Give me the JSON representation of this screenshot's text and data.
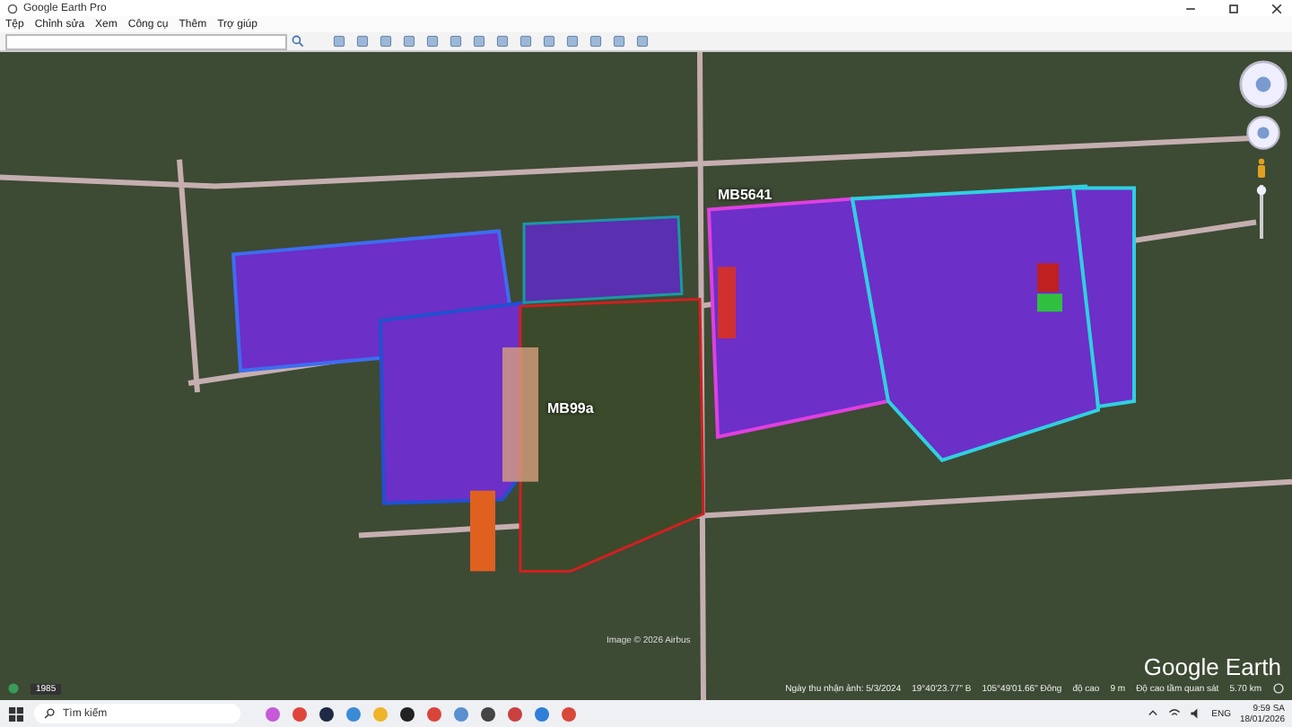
{
  "window": {
    "title": "Google Earth Pro"
  },
  "menu": [
    "Tệp",
    "Chỉnh sửa",
    "Xem",
    "Công cụ",
    "Thêm",
    "Trợ giúp"
  ],
  "map": {
    "labels": [
      {
        "text": "MB5641",
        "kind": "top"
      },
      {
        "text": "MB99a",
        "kind": "left"
      }
    ],
    "attribution": "Image © 2026 Airbus",
    "logo": "Google Earth",
    "history_badge": "1985",
    "status": [
      "Ngày thu nhận ảnh: 5/3/2024",
      "19°40'23.77\" B",
      "105°49'01.66\" Đông",
      "độ cao",
      "9 m",
      "Độ cao tầm quan sát",
      "5.70 km"
    ]
  },
  "taskbar": {
    "search_placeholder": "Tìm kiếm",
    "language": "ENG",
    "time": "9:59 SA",
    "date": "18/01/2026"
  }
}
